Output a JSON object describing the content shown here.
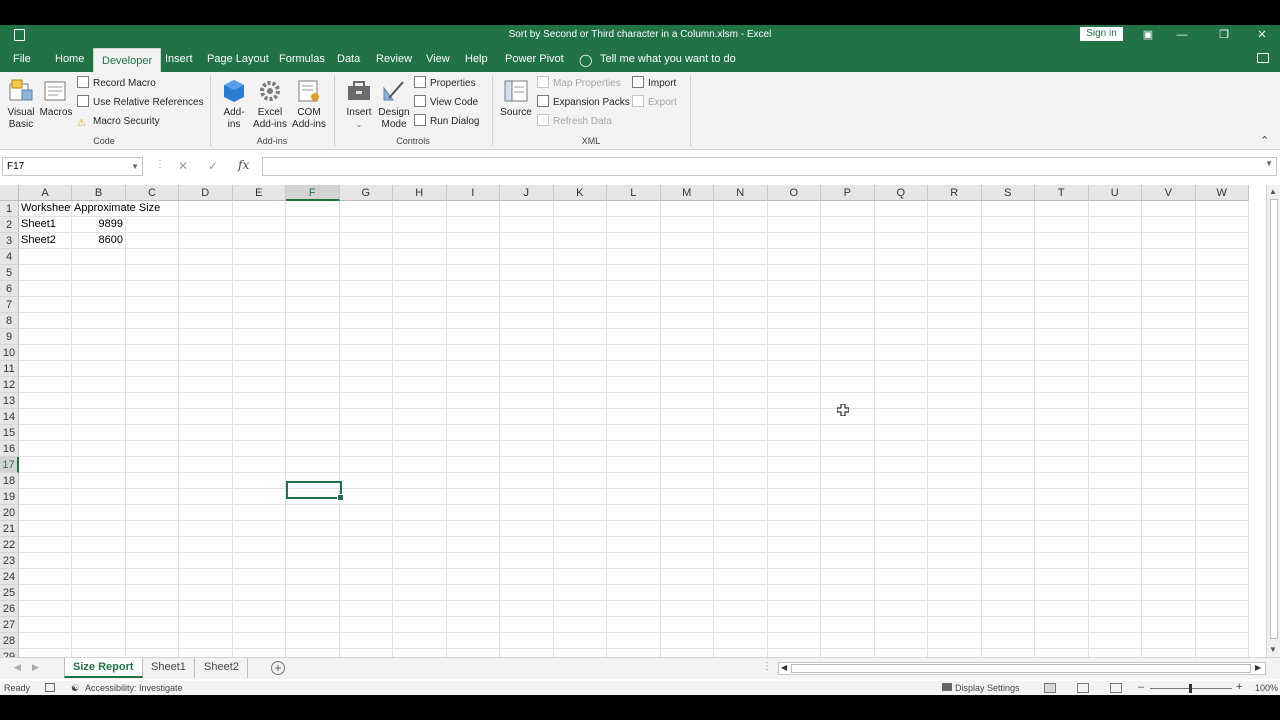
{
  "window": {
    "title": "Sort by Second or Third character in a Column.xlsm  -  Excel",
    "sign_in": "Sign in"
  },
  "tabs": [
    "File",
    "Home",
    "Developer",
    "Insert",
    "Page Layout",
    "Formulas",
    "Data",
    "Review",
    "View",
    "Help",
    "Power Pivot"
  ],
  "active_tab": "Developer",
  "tell_me": "Tell me what you want to do",
  "ribbon": {
    "code": {
      "visual_basic": "Visual Basic",
      "macros": "Macros",
      "record_macro": "Record Macro",
      "use_relative": "Use Relative References",
      "macro_security": "Macro Security",
      "label": "Code"
    },
    "addins": {
      "addins": "Add-ins",
      "excel_addins": "Excel Add-ins",
      "com_addins": "COM Add-ins",
      "label": "Add-ins"
    },
    "controls": {
      "insert": "Insert",
      "design_mode": "Design Mode",
      "properties": "Properties",
      "view_code": "View Code",
      "run_dialog": "Run Dialog",
      "label": "Controls"
    },
    "xml": {
      "source": "Source",
      "map_properties": "Map Properties",
      "expansion_packs": "Expansion Packs",
      "refresh_data": "Refresh Data",
      "import": "Import",
      "export": "Export",
      "label": "XML"
    }
  },
  "formula_bar": {
    "name_box": "F17",
    "fx": "fx",
    "formula": ""
  },
  "grid": {
    "columns": [
      "A",
      "B",
      "C",
      "D",
      "E",
      "F",
      "G",
      "H",
      "I",
      "J",
      "K",
      "L",
      "M",
      "N",
      "O",
      "P",
      "Q",
      "R",
      "S",
      "T",
      "U",
      "V",
      "W"
    ],
    "rows": [
      "1",
      "2",
      "3",
      "4",
      "5",
      "6",
      "7",
      "8",
      "9",
      "10",
      "11",
      "12",
      "13",
      "14",
      "15",
      "16",
      "17",
      "18",
      "19",
      "20",
      "21",
      "22",
      "23",
      "24",
      "25",
      "26",
      "27",
      "28",
      "29"
    ],
    "selected_col": "F",
    "selected_row": "17",
    "cells": {
      "A1": "Worksheet",
      "B1": "Approximate Size",
      "A2": "Sheet1",
      "B2": "9899",
      "A3": "Sheet2",
      "B3": "8600"
    }
  },
  "sheets": [
    "Size Report",
    "Sheet1",
    "Sheet2"
  ],
  "active_sheet": "Size Report",
  "status": {
    "ready": "Ready",
    "accessibility": "Accessibility: Investigate",
    "display_settings": "Display Settings",
    "zoom": "100%"
  },
  "colors": {
    "accent": "#217346",
    "ribbon_bg": "#f3f3f3"
  }
}
